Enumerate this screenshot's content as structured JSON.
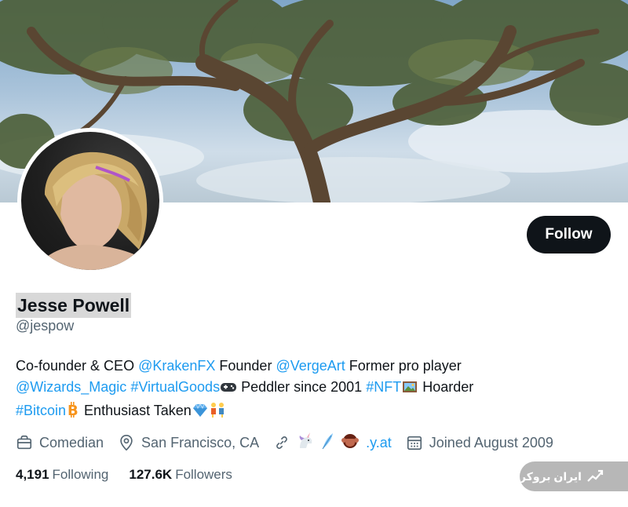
{
  "profile": {
    "name": "Jesse Powell",
    "handle": "@jespow",
    "follow_label": "Follow"
  },
  "bio": {
    "line1": {
      "t1": "Co-founder & CEO ",
      "l1": "@KrakenFX",
      "t2": " Founder ",
      "l2": "@VergeArt",
      "t3": " Former pro player"
    },
    "line2": {
      "l1": "@Wizards_Magic",
      "t1": " ",
      "l2": "#VirtualGoods",
      "t2": " Peddler since 2001 ",
      "l3": "#NFT",
      "t3": " Hoarder"
    },
    "line3": {
      "l1": "#Bitcoin",
      "t1": " Enthusiast Taken"
    }
  },
  "meta": {
    "profession": "Comedian",
    "location": "San Francisco, CA",
    "website": ".y.at",
    "joined": "Joined August 2009",
    "icons": [
      "briefcase-icon",
      "location-pin-icon",
      "link-icon",
      "calendar-icon"
    ]
  },
  "stats": {
    "following_count": "4,191",
    "following_label": "Following",
    "followers_count": "127.6K",
    "followers_label": "Followers"
  },
  "watermark": {
    "text": "ایران بروکر"
  },
  "colors": {
    "link": "#1d9bf0",
    "button_bg": "#0f1419",
    "secondary_text": "#536471"
  }
}
